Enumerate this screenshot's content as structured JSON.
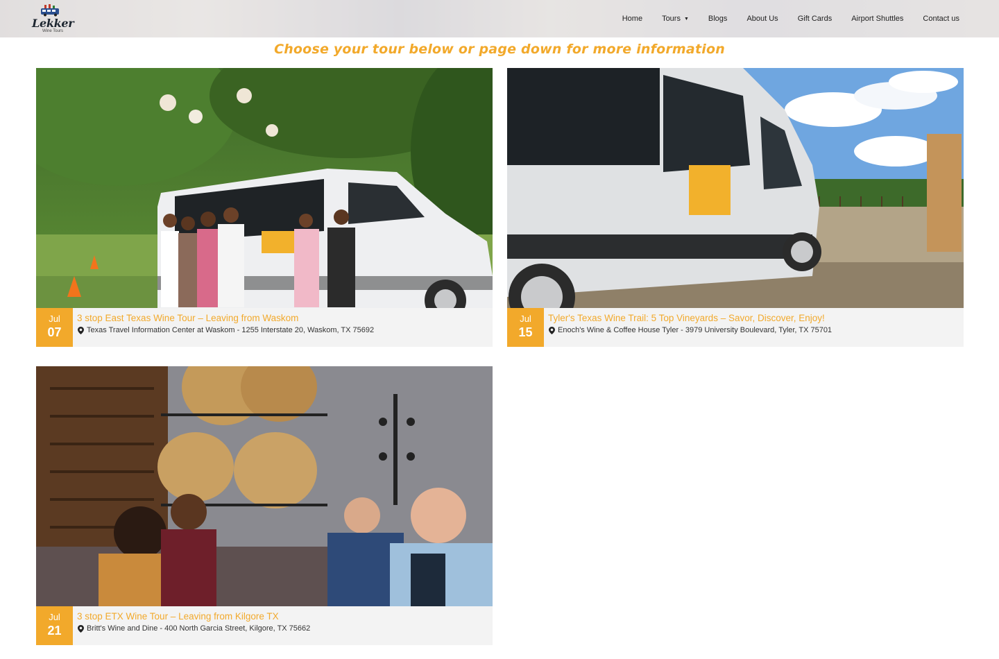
{
  "brand": {
    "logo_text": "Lekker",
    "logo_sub": "Wine Tours"
  },
  "nav": {
    "items": [
      {
        "label": "Home"
      },
      {
        "label": "Tours",
        "has_dropdown": true
      },
      {
        "label": "Blogs"
      },
      {
        "label": "About Us"
      },
      {
        "label": "Gift Cards"
      },
      {
        "label": "Airport Shuttles"
      },
      {
        "label": "Contact us"
      }
    ]
  },
  "tagline": "Choose your tour below or page down for more information",
  "colors": {
    "accent": "#f2a92b",
    "card_bg": "#f3f3f3"
  },
  "tours": [
    {
      "month": "Jul",
      "day": "07",
      "title": "3 stop East Texas Wine Tour – Leaving from Waskom",
      "location": "Texas Travel Information Center at Waskom - 1255 Interstate 20, Waskom, TX 75692",
      "image": "group-with-van-photo"
    },
    {
      "month": "Jul",
      "day": "15",
      "title": "Tyler's Texas Wine Trail: 5 Top Vineyards – Savor, Discover, Enjoy!",
      "location": "Enoch's Wine & Coffee House Tyler - 3979 University Boulevard, Tyler, TX 75701",
      "image": "van-at-vineyard-photo"
    },
    {
      "month": "Jul",
      "day": "21",
      "title": "3 stop ETX Wine Tour – Leaving from Kilgore TX",
      "location": "Britt's Wine and Dine - 400 North Garcia Street, Kilgore, TX 75662",
      "image": "wine-cellar-toast-photo"
    }
  ]
}
